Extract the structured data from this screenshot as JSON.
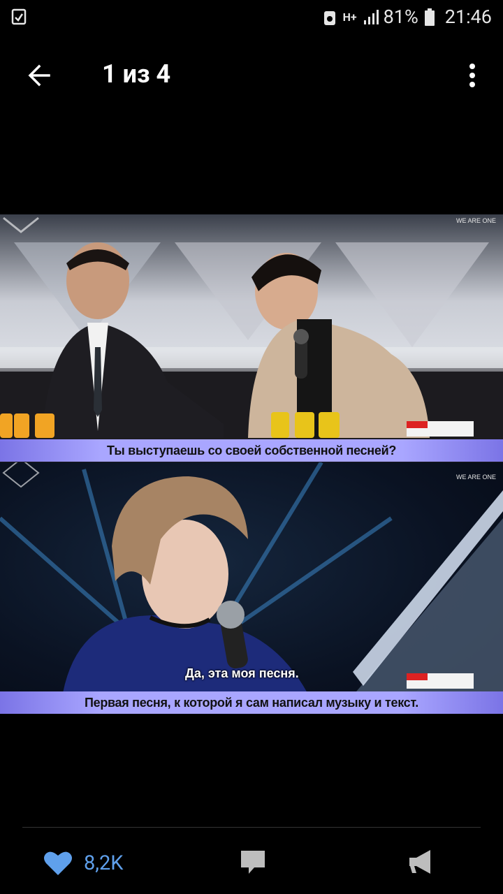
{
  "status_bar": {
    "battery": "81%",
    "time": "21:46",
    "network": "H+"
  },
  "topbar": {
    "title": "1 из 4"
  },
  "photo": {
    "top_caption": "Ты выступаешь со своей собственной песней?",
    "bottom_caption_line1": "Да, эта моя песня.",
    "bottom_caption_line2": "Первая песня, к которой я сам написал музыку и текст.",
    "watermark": "WE ARE ONE"
  },
  "actions": {
    "likes": "8,2K"
  },
  "colors": {
    "like": "#5fa0ec",
    "icon_gray": "#bdbdbd",
    "caption_bg": "#a9a6ff"
  }
}
